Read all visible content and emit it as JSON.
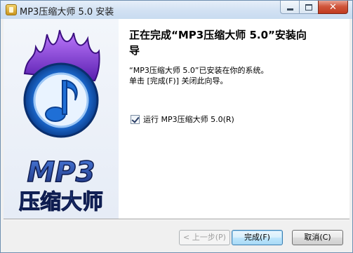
{
  "window": {
    "title": "MP3压缩大师 5.0 安装",
    "close_glyph": "✕"
  },
  "banner": {
    "logo_text_en": "MP3",
    "logo_text_cn": "压缩大师",
    "colors": {
      "flame": "#7a2fd6",
      "ring": "#1f6fd6",
      "note": "#ffffff",
      "text": "#1f3a8a"
    }
  },
  "content": {
    "heading_line1": "正在完成“MP3压缩大师 5.0”安装向",
    "heading_line2": "导",
    "body_line1": "“MP3压缩大师 5.0”已安装在你的系统。",
    "body_line2": "单击 [完成(F)] 关闭此向导。",
    "run_checkbox": {
      "label": "运行 MP3压缩大师 5.0(R)",
      "checked": true
    }
  },
  "footer": {
    "back_label": "< 上一步(P)",
    "finish_label": "完成(F)",
    "cancel_label": "取消(C)"
  }
}
